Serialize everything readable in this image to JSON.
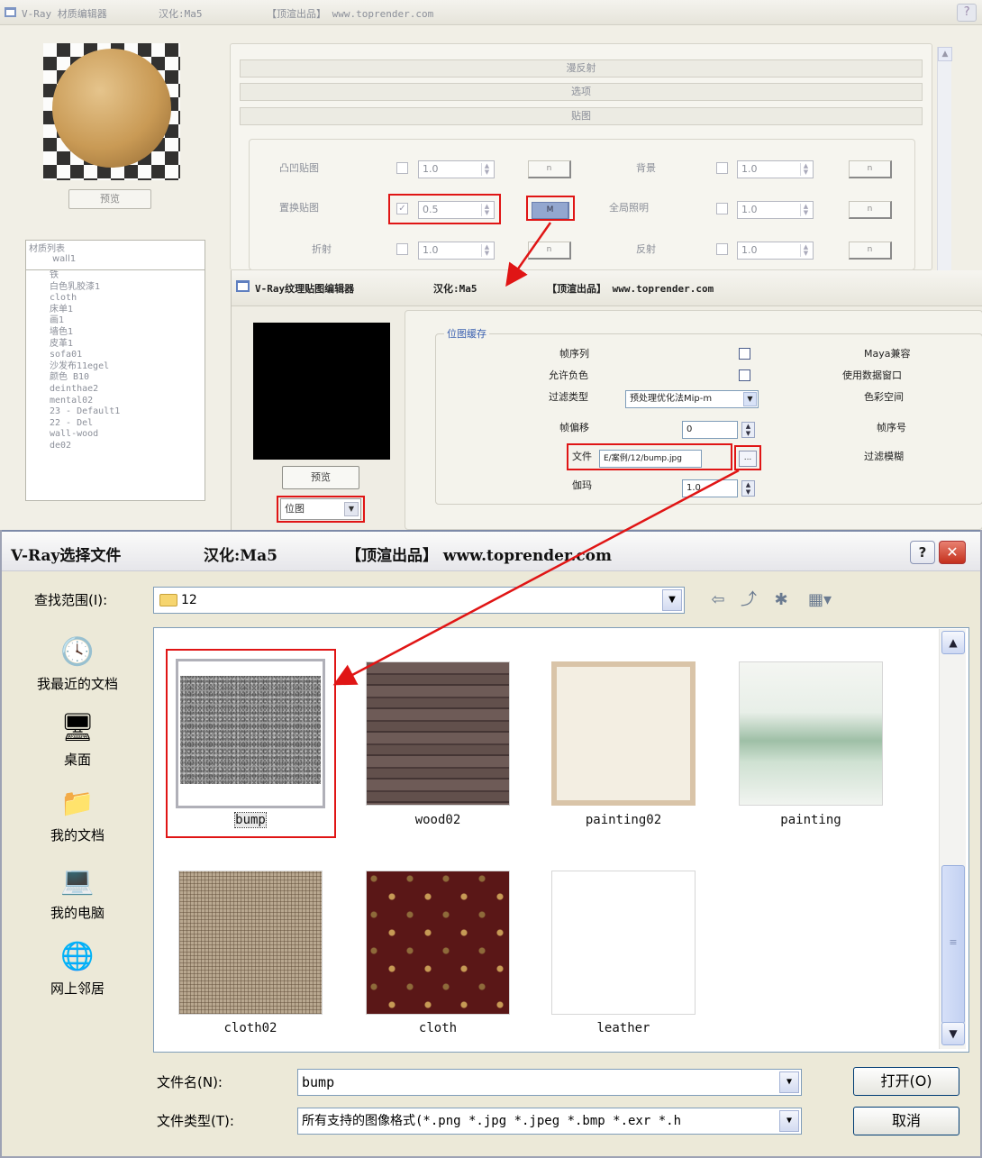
{
  "material_editor": {
    "title_parts": [
      "V-Ray 材质编辑器",
      "汉化:Ma5",
      "【顶渲出品】 www.toprender.com"
    ],
    "help_glyph": "?",
    "preview_button": "预览",
    "material_list_title": "材质列表",
    "material_list": [
      "wall1",
      "铁",
      "白色乳胶漆1",
      "cloth",
      "床单1",
      "画1",
      "墙色1",
      "皮革1",
      "sofa01",
      "沙发布11egel",
      "颜色 B10",
      "deinthae2",
      "mental02",
      "23 - Default1",
      "22 - Del",
      "wall-wood",
      "de02"
    ],
    "rollouts": [
      "漫反射",
      "选项",
      "贴图"
    ],
    "maps_left": [
      {
        "label": "凸凹贴图",
        "checked": false,
        "value": "1.0"
      },
      {
        "label": "置换贴图",
        "checked": true,
        "value": "0.5"
      },
      {
        "label": "折射",
        "checked": false,
        "value": "1.0"
      }
    ],
    "maps_right": [
      {
        "label": "背景",
        "checked": false,
        "value": "1.0"
      },
      {
        "label": "全局照明",
        "checked": false,
        "value": "1.0"
      },
      {
        "label": "反射",
        "checked": false,
        "value": "1.0"
      }
    ],
    "map_button_label": "n",
    "map_button_active_label": "M"
  },
  "texture_editor": {
    "title_parts": [
      "V-Ray纹理贴图编辑器",
      "汉化:Ma5",
      "【顶渲出品】 www.toprender.com"
    ],
    "preview_button": "预览",
    "type_value": "位图",
    "group_title": "位图缓存",
    "labels": {
      "frame_seq": "帧序列",
      "allow_neg": "允许负色",
      "filter_type": "过滤类型",
      "frame_offset": "帧偏移",
      "file": "文件",
      "gamma": "伽玛"
    },
    "filter_value": "预处理优化法Mip-m",
    "frame_offset_value": "0",
    "file_value": "E/案例/12/bump.jpg",
    "browse_glyph": "...",
    "gamma_value": "1.0",
    "right_labels": [
      "Maya兼容",
      "使用数据窗口",
      "色彩空间",
      "帧序号",
      "过滤模糊"
    ]
  },
  "file_dialog": {
    "title_parts": [
      "V-Ray选择文件",
      "汉化:Ma5",
      "【顶渲出品】 www.toprender.com"
    ],
    "help_glyph": "?",
    "close_glyph": "✕",
    "lookin_label": "查找范围(I):",
    "lookin_value": "12",
    "places": [
      {
        "label": "我最近的文档",
        "icon": "recent-docs-icon",
        "glyph": "🕓"
      },
      {
        "label": "桌面",
        "icon": "desktop-icon",
        "glyph": "🖥"
      },
      {
        "label": "我的文档",
        "icon": "my-docs-icon",
        "glyph": "📁"
      },
      {
        "label": "我的电脑",
        "icon": "my-computer-icon",
        "glyph": "💻"
      },
      {
        "label": "网上邻居",
        "icon": "network-icon",
        "glyph": "🌐"
      }
    ],
    "files": [
      {
        "name": "bump",
        "texture": "bump",
        "selected": true
      },
      {
        "name": "wood02",
        "texture": "wood"
      },
      {
        "name": "painting02",
        "texture": "painting02"
      },
      {
        "name": "painting",
        "texture": "painting"
      },
      {
        "name": "cloth02",
        "texture": "cloth02"
      },
      {
        "name": "cloth",
        "texture": "cloth"
      },
      {
        "name": "leather",
        "texture": "leather"
      }
    ],
    "filename_label": "文件名(N):",
    "filename_value": "bump",
    "filetype_label": "文件类型(T):",
    "filetype_value": "所有支持的图像格式(*.png *.jpg *.jpeg *.bmp *.exr *.h",
    "open_button": "打开(O)",
    "cancel_button": "取消",
    "scroll_up": "▲",
    "scroll_down": "▼",
    "dropdown_glyph": "▼"
  },
  "annotation_color": "#e01515"
}
